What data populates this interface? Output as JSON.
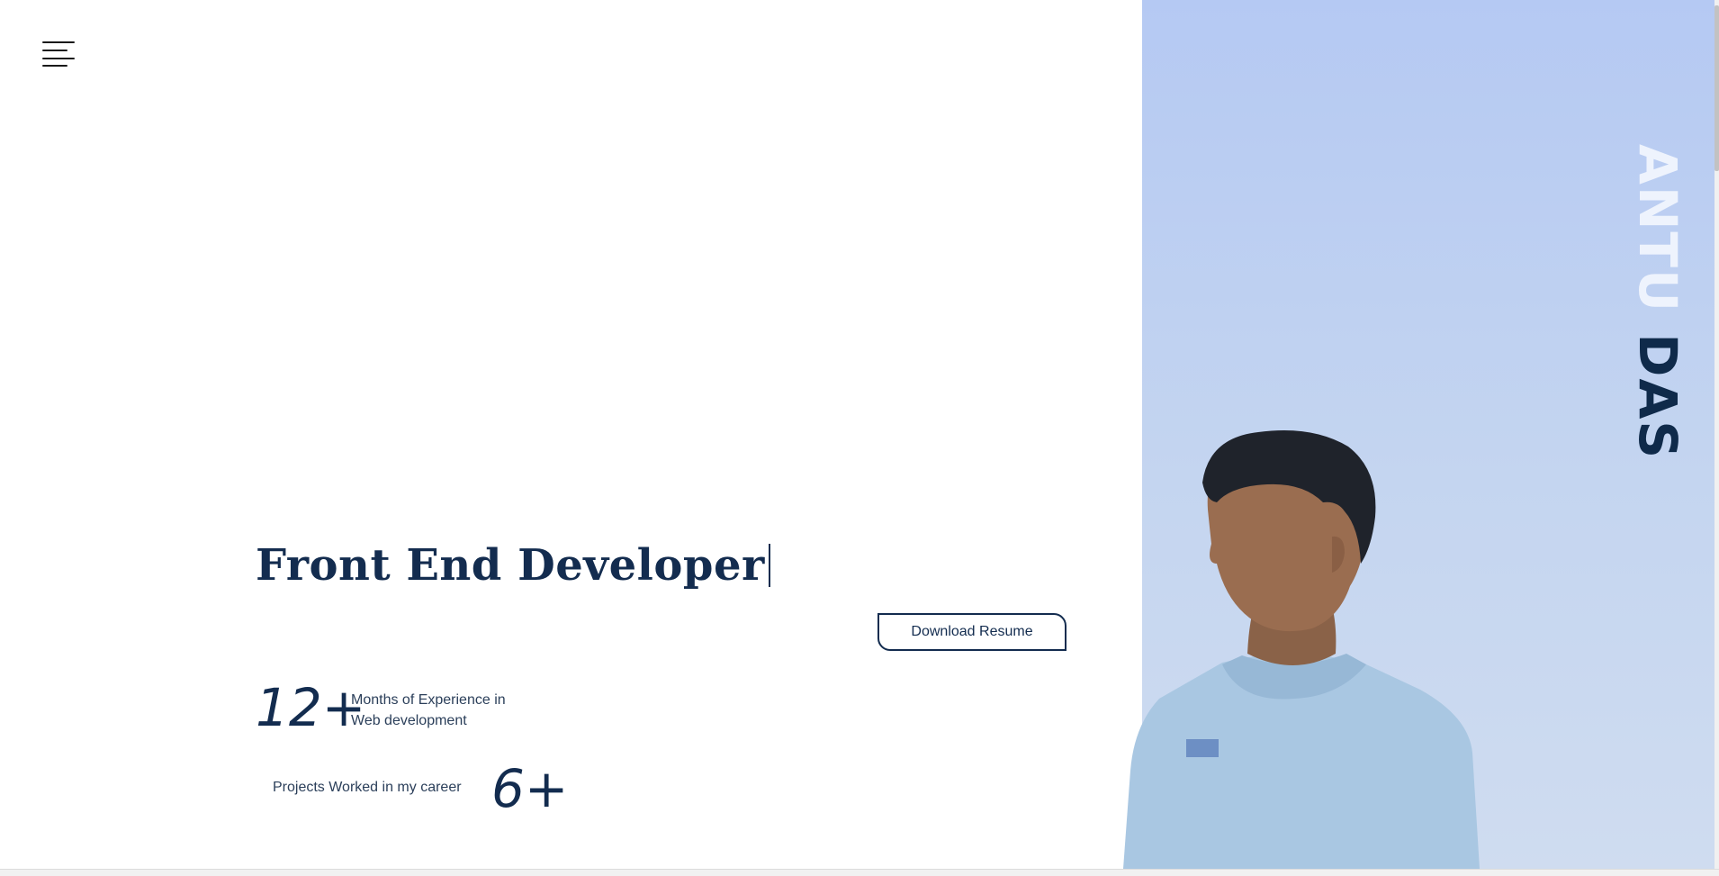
{
  "header": {
    "menu_icon": "hamburger-menu-icon"
  },
  "hero": {
    "headline": "Front End Developer",
    "download_label": "Download Resume"
  },
  "stats": {
    "experience_number": "12+",
    "experience_line1": "Months of Experience in",
    "experience_line2": "Web development",
    "projects_label": "Projects Worked in my career",
    "projects_number": "6+"
  },
  "side": {
    "name_first": "ANTU",
    "name_last": "DAS",
    "photo_icon": "portrait-photo"
  },
  "colors": {
    "primary": "#132c4f",
    "panel": "#b5c9f3",
    "background": "#ffffff"
  }
}
